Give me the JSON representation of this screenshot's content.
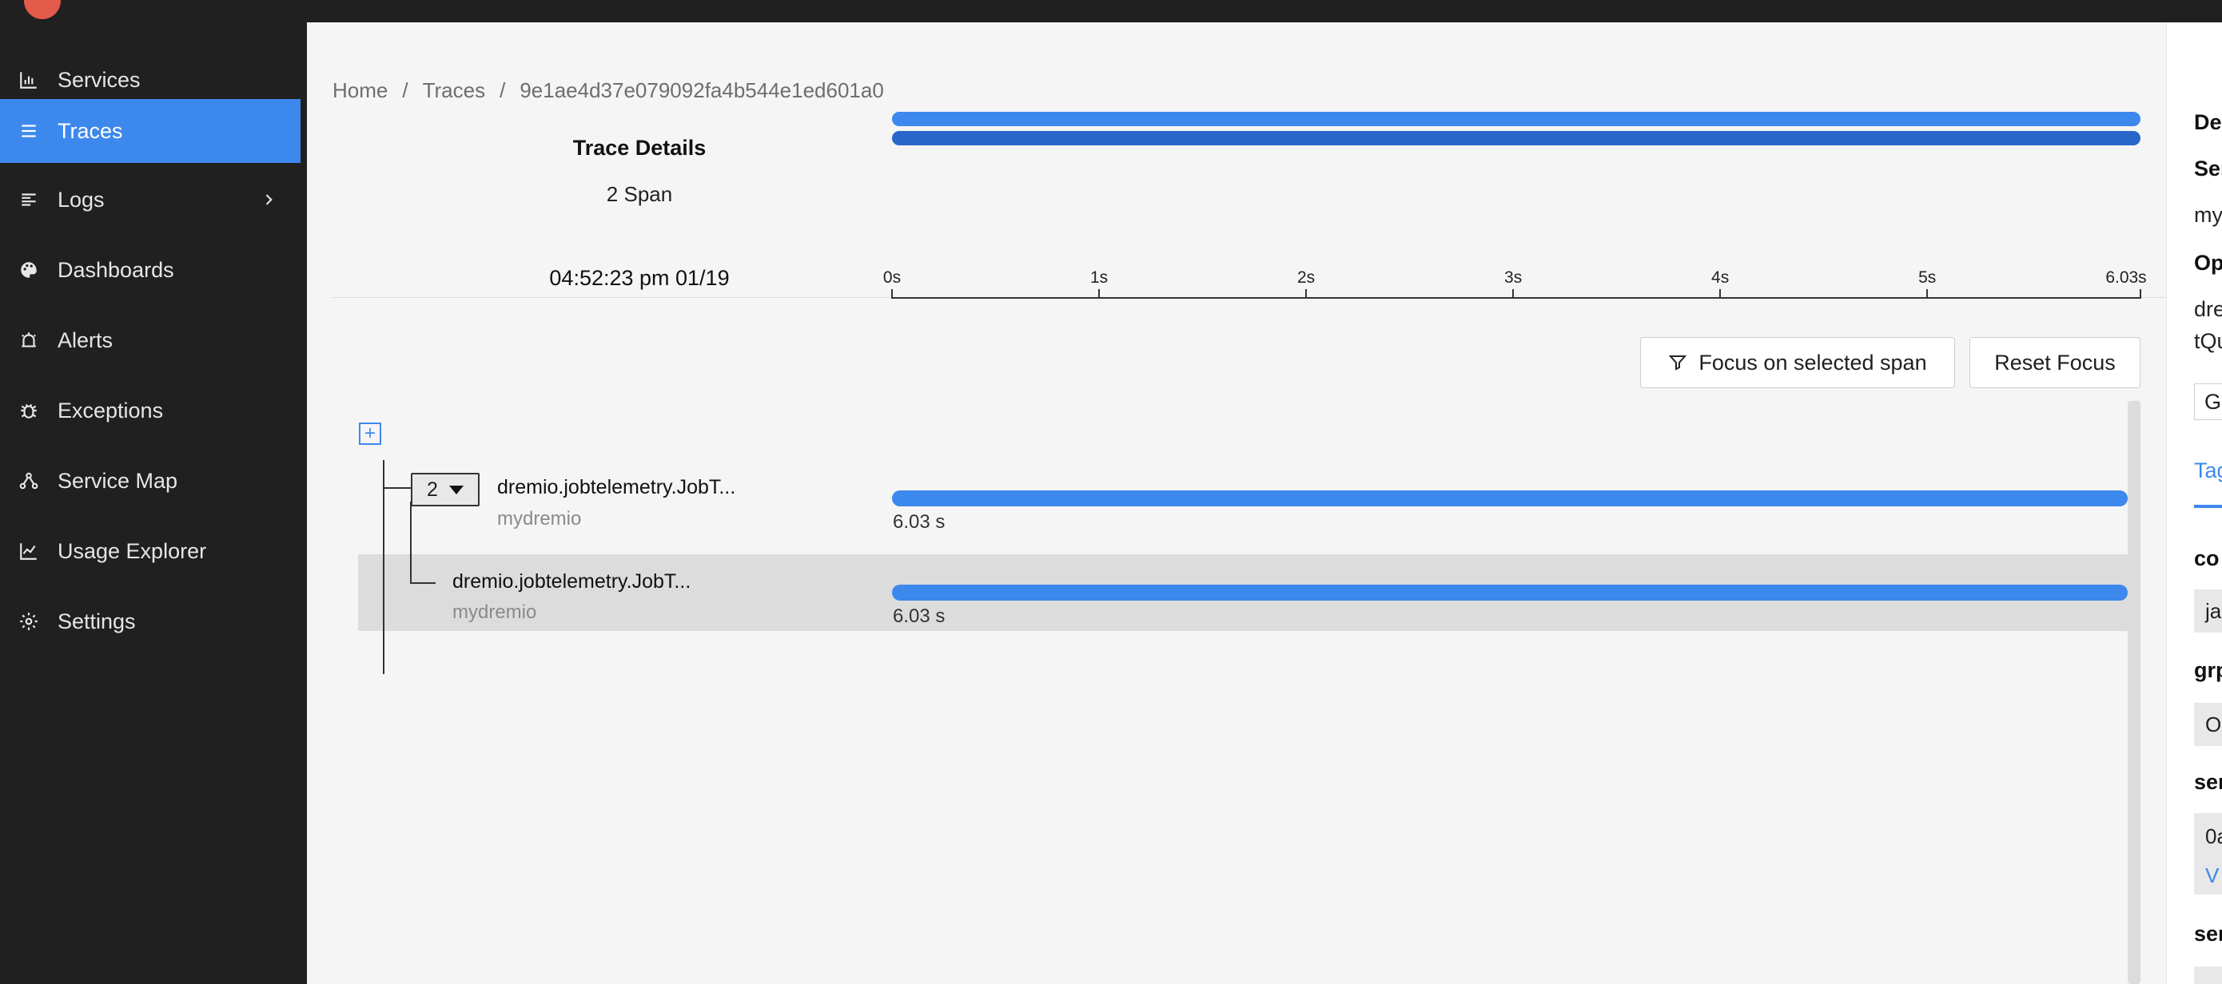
{
  "sidebar": {
    "items": [
      {
        "label": "Services",
        "icon": "bar-chart-icon"
      },
      {
        "label": "Traces",
        "icon": "list-icon",
        "active": true
      },
      {
        "label": "Logs",
        "icon": "align-left-icon",
        "has_submenu": true
      },
      {
        "label": "Dashboards",
        "icon": "palette-icon"
      },
      {
        "label": "Alerts",
        "icon": "alarm-clock-icon"
      },
      {
        "label": "Exceptions",
        "icon": "bug-icon"
      },
      {
        "label": "Service Map",
        "icon": "deployment-icon"
      },
      {
        "label": "Usage Explorer",
        "icon": "line-chart-icon"
      },
      {
        "label": "Settings",
        "icon": "gear-icon"
      }
    ]
  },
  "breadcrumb": {
    "home": "Home",
    "sep": "/",
    "traces": "Traces",
    "trace_id": "9e1ae4d37e079092fa4b544e1ed601a0"
  },
  "trace": {
    "title": "Trace Details",
    "span_count": "2 Span",
    "start_time": "04:52:23 pm 01/19"
  },
  "timeline": {
    "ticks": [
      "0s",
      "1s",
      "2s",
      "3s",
      "4s",
      "5s",
      "6.03s"
    ]
  },
  "buttons": {
    "focus": "Focus on selected span",
    "reset": "Reset Focus"
  },
  "spans": [
    {
      "name": "dremio.jobtelemetry.JobT...",
      "service": "mydremio",
      "duration": "6.03 s",
      "children": "2"
    },
    {
      "name": "dremio.jobtelemetry.JobT...",
      "service": "mydremio",
      "duration": "6.03 s",
      "selected": true
    }
  ],
  "details_panel": {
    "details_heading": "De",
    "service_label": "Ser",
    "service_value": "my",
    "operation_label": "Op",
    "operation_line1": "dre",
    "operation_line2": "tQu",
    "go_button": "G",
    "tab_tags": "Tag",
    "tag1_key": "co",
    "tag1_value": "ja",
    "tag2_key": "grp",
    "tag2_value": "O",
    "tag3_key": "ser",
    "tag3_value": "0a",
    "tag3_link": "V",
    "tag4_key": "ser"
  },
  "colors": {
    "accent": "#3d88ec",
    "accent_dark": "#2966c9",
    "sidebar_bg": "#202020"
  }
}
